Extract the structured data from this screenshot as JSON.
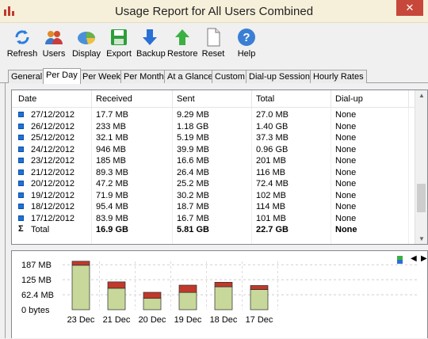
{
  "window": {
    "title": "Usage Report for All Users Combined",
    "close_glyph": "✕"
  },
  "toolbar": {
    "buttons": [
      {
        "label": "Refresh",
        "icon": "refresh-icon"
      },
      {
        "label": "Users",
        "icon": "users-icon"
      },
      {
        "label": "Display",
        "icon": "display-icon"
      },
      {
        "label": "Export",
        "icon": "export-icon"
      },
      {
        "label": "Backup",
        "icon": "backup-icon"
      },
      {
        "label": "Restore",
        "icon": "restore-icon"
      },
      {
        "label": "Reset",
        "icon": "reset-icon"
      },
      {
        "label": "Help",
        "icon": "help-icon"
      }
    ]
  },
  "tabs": [
    {
      "label": "General"
    },
    {
      "label": "Per Day",
      "active": true
    },
    {
      "label": "Per Week"
    },
    {
      "label": "Per Month"
    },
    {
      "label": "At a Glance"
    },
    {
      "label": "Custom"
    },
    {
      "label": "Dial-up Sessions"
    },
    {
      "label": "Hourly Rates"
    }
  ],
  "table": {
    "columns": [
      "Date",
      "Received",
      "Sent",
      "Total",
      "Dial-up"
    ],
    "rows": [
      {
        "date": "27/12/2012",
        "received": "17.7 MB",
        "sent": "9.29 MB",
        "total": "27.0 MB",
        "dialup": "None"
      },
      {
        "date": "26/12/2012",
        "received": "233 MB",
        "sent": "1.18 GB",
        "total": "1.40 GB",
        "dialup": "None"
      },
      {
        "date": "25/12/2012",
        "received": "32.1 MB",
        "sent": "5.19 MB",
        "total": "37.3 MB",
        "dialup": "None"
      },
      {
        "date": "24/12/2012",
        "received": "946 MB",
        "sent": "39.9 MB",
        "total": "0.96 GB",
        "dialup": "None"
      },
      {
        "date": "23/12/2012",
        "received": "185 MB",
        "sent": "16.6 MB",
        "total": "201 MB",
        "dialup": "None"
      },
      {
        "date": "21/12/2012",
        "received": "89.3 MB",
        "sent": "26.4 MB",
        "total": "116 MB",
        "dialup": "None"
      },
      {
        "date": "20/12/2012",
        "received": "47.2 MB",
        "sent": "25.2 MB",
        "total": "72.4 MB",
        "dialup": "None"
      },
      {
        "date": "19/12/2012",
        "received": "71.9 MB",
        "sent": "30.2 MB",
        "total": "102 MB",
        "dialup": "None"
      },
      {
        "date": "18/12/2012",
        "received": "95.4 MB",
        "sent": "18.7 MB",
        "total": "114 MB",
        "dialup": "None"
      },
      {
        "date": "17/12/2012",
        "received": "83.9 MB",
        "sent": "16.7 MB",
        "total": "101 MB",
        "dialup": "None"
      }
    ],
    "total_row": {
      "symbol": "Σ",
      "date": "Total",
      "received": "16.9 GB",
      "sent": "5.81 GB",
      "total": "22.7 GB",
      "dialup": "None"
    }
  },
  "chart_data": {
    "type": "bar",
    "categories": [
      "23 Dec",
      "21 Dec",
      "20 Dec",
      "19 Dec",
      "18 Dec",
      "17 Dec"
    ],
    "series": [
      {
        "name": "Received",
        "values": [
          185,
          89.3,
          47.2,
          71.9,
          95.4,
          83.9
        ],
        "color": "#c8d89a"
      },
      {
        "name": "Sent",
        "values": [
          16.6,
          26.4,
          25.2,
          30.2,
          18.7,
          16.7
        ],
        "color": "#c0392b"
      }
    ],
    "y_ticks": [
      "187 MB",
      "125 MB",
      "62.4 MB",
      "0 bytes"
    ],
    "y_tick_values": [
      187,
      125,
      62.4,
      0
    ],
    "ylim": [
      0,
      201
    ],
    "grid": true,
    "stacked": true
  }
}
